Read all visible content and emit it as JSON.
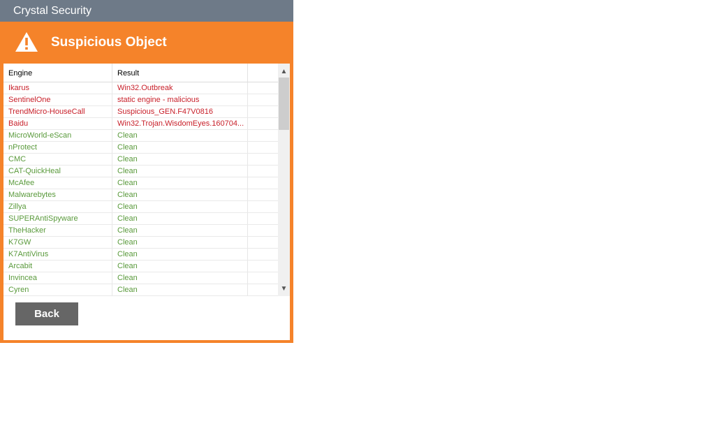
{
  "window": {
    "title": "Crystal Security"
  },
  "header": {
    "title": "Suspicious Object",
    "icon": "warning-icon"
  },
  "table": {
    "columns": [
      "Engine",
      "Result"
    ],
    "rows": [
      {
        "engine": "Ikarus",
        "result": "Win32.Outbreak",
        "status": "malicious"
      },
      {
        "engine": "SentinelOne",
        "result": "static engine - malicious",
        "status": "malicious"
      },
      {
        "engine": "TrendMicro-HouseCall",
        "result": "Suspicious_GEN.F47V0816",
        "status": "malicious"
      },
      {
        "engine": "Baidu",
        "result": "Win32.Trojan.WisdomEyes.160704...",
        "status": "malicious"
      },
      {
        "engine": "MicroWorld-eScan",
        "result": "Clean",
        "status": "clean"
      },
      {
        "engine": "nProtect",
        "result": "Clean",
        "status": "clean"
      },
      {
        "engine": "CMC",
        "result": "Clean",
        "status": "clean"
      },
      {
        "engine": "CAT-QuickHeal",
        "result": "Clean",
        "status": "clean"
      },
      {
        "engine": "McAfee",
        "result": "Clean",
        "status": "clean"
      },
      {
        "engine": "Malwarebytes",
        "result": "Clean",
        "status": "clean"
      },
      {
        "engine": "Zillya",
        "result": "Clean",
        "status": "clean"
      },
      {
        "engine": "SUPERAntiSpyware",
        "result": "Clean",
        "status": "clean"
      },
      {
        "engine": "TheHacker",
        "result": "Clean",
        "status": "clean"
      },
      {
        "engine": "K7GW",
        "result": "Clean",
        "status": "clean"
      },
      {
        "engine": "K7AntiVirus",
        "result": "Clean",
        "status": "clean"
      },
      {
        "engine": "Arcabit",
        "result": "Clean",
        "status": "clean"
      },
      {
        "engine": "Invincea",
        "result": "Clean",
        "status": "clean"
      },
      {
        "engine": "Cyren",
        "result": "Clean",
        "status": "clean"
      }
    ]
  },
  "buttons": {
    "back_label": "Back"
  },
  "colors": {
    "accent": "#f5832a",
    "titlebar": "#6e7a88",
    "malicious": "#c8202a",
    "clean": "#5a9a3c",
    "button": "#666666"
  }
}
